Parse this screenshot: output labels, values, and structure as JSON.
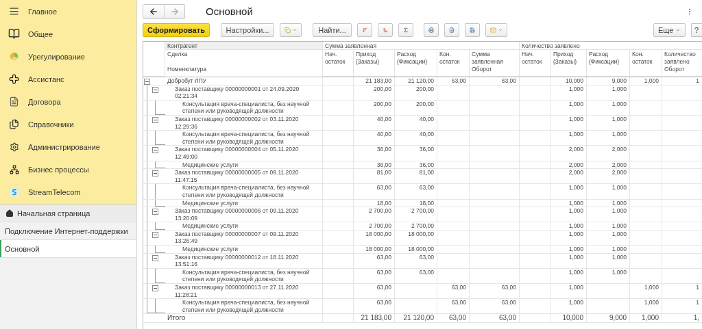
{
  "sidebar": {
    "sections": [
      {
        "label": "Главное"
      },
      {
        "label": "Общее"
      },
      {
        "label": "Урегулирование"
      },
      {
        "label": "Ассистанс"
      },
      {
        "label": "Договора"
      },
      {
        "label": "Справочники"
      },
      {
        "label": "Администрирование"
      },
      {
        "label": "Бизнес процессы"
      },
      {
        "label": "StreamTelecom"
      }
    ],
    "open_pages": [
      {
        "label": "Начальная страница",
        "kind": "home",
        "selected": false
      },
      {
        "label": "Подключение Интернет-поддержки",
        "kind": "page",
        "selected": false
      },
      {
        "label": "Основной",
        "kind": "page",
        "selected": true
      }
    ]
  },
  "navigation": {
    "back_disabled": false,
    "forward_disabled": true
  },
  "title": "Основной",
  "toolbar": {
    "generate": "Сформировать",
    "settings": "Настройки...",
    "find": "Найти...",
    "more": "Еще",
    "help": "?"
  },
  "table": {
    "tree_headers": [
      "Контрагент",
      "Сделка",
      "Номенклатура"
    ],
    "groups": [
      {
        "title": "Сумма заявленная",
        "columns": [
          "Нач. остаток",
          "Приход (Заказы)",
          "Расход (Фиксации)",
          "Кон. остаток",
          "Сумма заявленная Оборот"
        ]
      },
      {
        "title": "Количество заявлено",
        "columns": [
          "Нач. остаток",
          "Приход (Заказы)",
          "Расход (Фиксации)",
          "Кон. остаток",
          "Количество заявлено Оборот"
        ]
      }
    ],
    "rows": [
      {
        "label": "Добробут ЛПУ",
        "expanded": true,
        "cells": {
          "column_2": "21 183,00",
          "column_3": "21 120,00",
          "column_4": "63,00",
          "column_5": "63,00",
          "column_7": "10,000",
          "column_8": "9,000",
          "column_9": "1,000",
          "column_10": "1"
        },
        "children": [
          {
            "label": "Заказ поставщику 00000000001 от 24.09.2020 02:21:34",
            "expanded": true,
            "cells": {
              "column_2": "200,00",
              "column_3": "200,00",
              "column_7": "1,000",
              "column_8": "1,000"
            },
            "children": [
              {
                "label": "Консультация врача-специалиста, без научной степени или руководящей должности",
                "cells": {
                  "column_2": "200,00",
                  "column_3": "200,00",
                  "column_7": "1,000",
                  "column_8": "1,000"
                }
              }
            ]
          },
          {
            "label": "Заказ поставщику 00000000002 от 03.11.2020 12:29:36",
            "expanded": true,
            "cells": {
              "column_2": "40,00",
              "column_3": "40,00",
              "column_7": "1,000",
              "column_8": "1,000"
            },
            "children": [
              {
                "label": "Консультация врача-специалиста, без научной степени или руководящей должности",
                "cells": {
                  "column_2": "40,00",
                  "column_3": "40,00",
                  "column_7": "1,000",
                  "column_8": "1,000"
                }
              }
            ]
          },
          {
            "label": "Заказ поставщику 00000000004 от 05.11.2020 12:49:00",
            "expanded": true,
            "cells": {
              "column_2": "36,00",
              "column_3": "36,00",
              "column_7": "2,000",
              "column_8": "2,000"
            },
            "children": [
              {
                "label": "Медицинские услуги",
                "cells": {
                  "column_2": "36,00",
                  "column_3": "36,00",
                  "column_7": "2,000",
                  "column_8": "2,000"
                }
              }
            ]
          },
          {
            "label": "Заказ поставщику 00000000005 от 09.11.2020 11:47:15",
            "expanded": true,
            "cells": {
              "column_2": "81,00",
              "column_3": "81,00",
              "column_7": "2,000",
              "column_8": "2,000"
            },
            "children": [
              {
                "label": "Консультация врача-специалиста, без научной степени или руководящей должности",
                "cells": {
                  "column_2": "63,00",
                  "column_3": "63,00",
                  "column_7": "1,000",
                  "column_8": "1,000"
                }
              },
              {
                "label": "Медицинские услуги",
                "cells": {
                  "column_2": "18,00",
                  "column_3": "18,00",
                  "column_7": "1,000",
                  "column_8": "1,000"
                }
              }
            ]
          },
          {
            "label": "Заказ поставщику 00000000006 от 09.11.2020 13:20:09",
            "expanded": true,
            "cells": {
              "column_2": "2 700,00",
              "column_3": "2 700,00",
              "column_7": "1,000",
              "column_8": "1,000"
            },
            "children": [
              {
                "label": "Медицинские услуги",
                "cells": {
                  "column_2": "2 700,00",
                  "column_3": "2 700,00",
                  "column_7": "1,000",
                  "column_8": "1,000"
                }
              }
            ]
          },
          {
            "label": "Заказ поставщику 00000000007 от 09.11.2020 13:26:49",
            "expanded": true,
            "cells": {
              "column_2": "18 000,00",
              "column_3": "18 000,00",
              "column_7": "1,000",
              "column_8": "1,000"
            },
            "children": [
              {
                "label": "Медицинские услуги",
                "cells": {
                  "column_2": "18 000,00",
                  "column_3": "18 000,00",
                  "column_7": "1,000",
                  "column_8": "1,000"
                }
              }
            ]
          },
          {
            "label": "Заказ поставщику 00000000012 от 18.11.2020 13:51:16",
            "expanded": true,
            "cells": {
              "column_2": "63,00",
              "column_3": "63,00",
              "column_7": "1,000",
              "column_8": "1,000"
            },
            "children": [
              {
                "label": "Консультация врача-специалиста, без научной степени или руководящей должности",
                "cells": {
                  "column_2": "63,00",
                  "column_3": "63,00",
                  "column_7": "1,000",
                  "column_8": "1,000"
                }
              }
            ]
          },
          {
            "label": "Заказ поставщику 00000000013 от 27.11.2020 11:28:21",
            "expanded": true,
            "cells": {
              "column_2": "63,00",
              "column_4": "63,00",
              "column_5": "63,00",
              "column_7": "1,000",
              "column_9": "1,000",
              "column_10": "1"
            },
            "children": [
              {
                "label": "Консультация врача-специалиста, без научной степени или руководящей должности",
                "cells": {
                  "column_2": "63,00",
                  "column_4": "63,00",
                  "column_5": "63,00",
                  "column_7": "1,000",
                  "column_9": "1,000",
                  "column_10": "1"
                }
              }
            ]
          }
        ]
      }
    ],
    "total": {
      "label": "Итого",
      "cells": {
        "column_2": "21 183,00",
        "column_3": "21 120,00",
        "column_4": "63,00",
        "column_5": "63,00",
        "column_7": "10,000",
        "column_8": "9,000",
        "column_9": "1,000",
        "column_10": "1,"
      }
    }
  }
}
